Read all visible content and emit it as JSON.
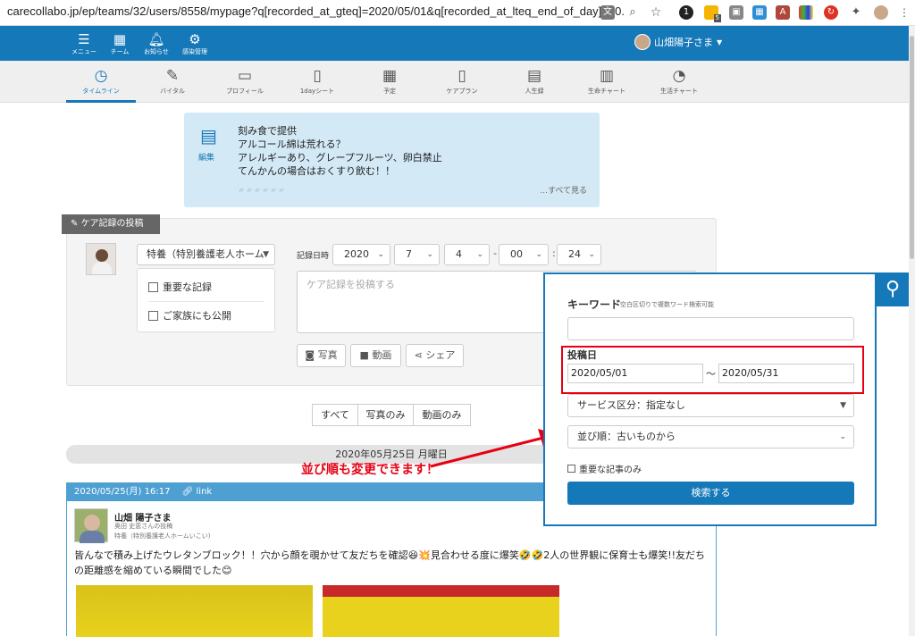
{
  "browser": {
    "url": "carecollabo.jp/ep/teams/32/users/8558/mypage?q[recorded_at_gteq]=2020/05/01&q[recorded_at_lteq_end_of_day]=20...",
    "ext_badge": "5"
  },
  "header": {
    "nav": [
      {
        "icon": "menu-icon",
        "label": "メニュー"
      },
      {
        "icon": "team-icon",
        "label": "チーム"
      },
      {
        "icon": "bell-icon",
        "label": "お知らせ"
      },
      {
        "icon": "gears-icon",
        "label": "感染管理"
      }
    ],
    "user_name": "山畑陽子さま"
  },
  "tabs": [
    {
      "icon": "clock-icon",
      "label": "タイムライン",
      "active": true
    },
    {
      "icon": "thermometer-icon",
      "label": "バイタル"
    },
    {
      "icon": "profile-card-icon",
      "label": "プロフィール"
    },
    {
      "icon": "clipboard-icon",
      "label": "1dayシート"
    },
    {
      "icon": "calendar-icon",
      "label": "予定"
    },
    {
      "icon": "clipboard-icon",
      "label": "ケアプラン"
    },
    {
      "icon": "book-icon",
      "label": "人生録"
    },
    {
      "icon": "bar-chart-icon",
      "label": "生命チャート"
    },
    {
      "icon": "pie-chart-icon",
      "label": "生活チャート"
    }
  ],
  "notice": {
    "edit_label": "編集",
    "lines": [
      "刻み食で提供",
      "アルコール綿は荒れる？",
      "アレルギーあり、グレープフルーツ、卵白禁止",
      "てんかんの場合はおくすり飲む！！"
    ],
    "faded": "〃〃〃〃〃〃",
    "more": "...すべて見る"
  },
  "post": {
    "header": "ケア記録の投稿",
    "facility": "特養（特別養護老人ホーム",
    "important_label": "重要な記録",
    "family_label": "ご家族にも公開",
    "datetime_label": "記録日時",
    "year": "2020",
    "month": "7",
    "day": "4",
    "hour": "00",
    "minute": "24",
    "placeholder": "ケア記録を投稿する",
    "photo_btn": "写真",
    "video_btn": "動画",
    "share_btn": "シェア"
  },
  "filters": {
    "all": "すべて",
    "photos": "写真のみ",
    "videos": "動画のみ"
  },
  "date_bar": "2020年05月25日 月曜日",
  "annotation": "並び順も変更できます！",
  "entry": {
    "header": "2020/05/25(月) 16:17",
    "link": "link",
    "resident": "山畑 陽子さま",
    "posted_by": "奥田 史恵さんの投稿",
    "facility": "特養（特別養護老人ホームいこい)",
    "body": "皆んなで積み上げたウレタンブロック！！穴から顔を覗かせて友だちを確認😆💥見合わせる度に爆笑🤣🤣2人の世界観に保育士も爆笑!!友だちの距離感を縮めている瞬間でした😊"
  },
  "search": {
    "keyword_label": "キーワード",
    "keyword_hint": "空白区切りで複数ワード検索可能",
    "date_label": "投稿日",
    "date_from": "2020/05/01",
    "tilde": "〜",
    "date_to": "2020/05/31",
    "service": "サービス区分：指定なし",
    "sort": "並び順：古いものから",
    "important_only": "重要な記事のみ",
    "submit": "検索する"
  },
  "colors": {
    "brand": "#1578b8",
    "annotation_red": "#e60012",
    "notice_bg": "#d3e9f6"
  }
}
